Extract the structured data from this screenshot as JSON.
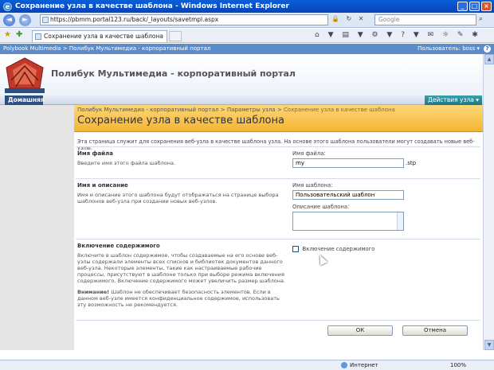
{
  "window": {
    "title": "Сохранение узла в качестве шаблона - Windows Internet Explorer",
    "controls": {
      "minimize": "_",
      "maximize": "□",
      "close": "×"
    }
  },
  "address_bar": {
    "url": "https://pbmm.portal123.ru/back/_layouts/savetmpl.aspx",
    "search_placeholder": "Google",
    "back_glyph": "◄",
    "forward_glyph": "►",
    "tools": "🔒 ↻ ✕",
    "search_glyph": "⌕"
  },
  "tabs": {
    "active_tab": "Сохранение узла в качестве шаблона",
    "favorites_glyph": "★",
    "add_favorite_glyph": "✚",
    "command_icons": "⌂ ▼ ▤ ▼ ⚙ ▼ ? ▼ ✉ ☼ ✎ ✱"
  },
  "sp_global": {
    "site": "Polybook Multimedia",
    "separator": ">",
    "portal": "Полибук Мультимедиа - корпоративный портал",
    "user": "Пользователь: boss ▾",
    "help": "?"
  },
  "header": {
    "site_title": "Полибук Мультимедиа - корпоративный портал",
    "home_tab": "Домашняя",
    "site_actions": "Действия узла ▾"
  },
  "page": {
    "breadcrumb": [
      "Полибук Мультимедиа - корпоративный портал",
      "Параметры узла",
      "Сохранение узла в качестве шаблона"
    ],
    "breadcrumb_sep": ">",
    "title": "Сохранение узла в качестве шаблона",
    "description": "Эта страница служит для сохранения веб-узла в качестве шаблона узла. На основе этого шаблона пользователи могут создавать новые веб-узлы."
  },
  "sections": {
    "file": {
      "title": "Имя файла",
      "text": "Введите имя этого файла шаблона.",
      "field_label": "Имя файла:",
      "value": "my",
      "suffix": ".stp"
    },
    "name": {
      "title": "Имя и описание",
      "text": "Имя и описание этого шаблона будут отображаться на странице выбора шаблонов веб-узла при создании новых веб-узлов.",
      "name_label": "Имя шаблона:",
      "name_value": "Пользовательский шаблон",
      "desc_label": "Описание шаблона:"
    },
    "content": {
      "title": "Включение содержимого",
      "text": "Включите в шаблон содержимое, чтобы создаваемые на его основе веб-узлы содержали элементы всех списков и библиотек документов данного веб-узла. Некоторые элементы, такие как настраиваемые рабочие процессы, присутствуют в шаблоне только при выборе режима включения содержимого. Включение содержимого может увеличить размер шаблона.",
      "warning_bold": "Внимание!",
      "warning_text": "Шаблон не обеспечивает безопасность элементов. Если в данном веб-узле имеется конфиденциальное содержимое, использовать эту возможность не рекомендуется.",
      "checkbox_label": "Включение содержимого"
    }
  },
  "buttons": {
    "ok": "ОК",
    "cancel": "Отмена"
  },
  "status": {
    "zone": "Интернет",
    "zoom": "100%"
  },
  "scroll": {
    "up": "▲",
    "down": "▼"
  }
}
